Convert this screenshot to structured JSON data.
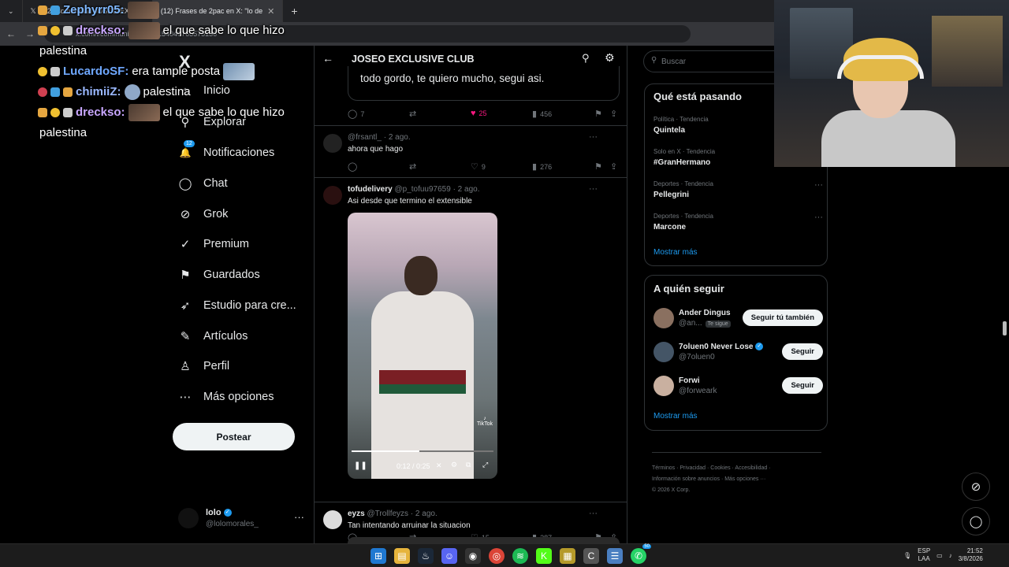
{
  "browser": {
    "tabs": [
      {
        "label": "(12) Comunidad JOSEO EXCL..."
      },
      {
        "label": "(12) Frases de 2pac en X: \"lo de",
        "active": true
      }
    ],
    "url": "x.com/i/communities/1803154040765575136"
  },
  "chat_overlay": [
    {
      "user": "Zephyrr05:",
      "msg": "",
      "color": "#7fb8ff"
    },
    {
      "user": "dreckso:",
      "msg": "el que sabe lo que hizo",
      "color": "#c9a7ff"
    },
    {
      "user": "",
      "msg": "palestina",
      "color": "#ffffff"
    },
    {
      "user": "LucardoSF:",
      "msg": "era tample posta",
      "color": "#6fa8ff"
    },
    {
      "user": "chimiiZ:",
      "msg": "palestina",
      "color": "#9ab8ff"
    },
    {
      "user": "dreckso:",
      "msg": "el que sabe lo que hizo",
      "color": "#c9a7ff"
    },
    {
      "user": "",
      "msg": "palestina",
      "color": "#ffffff"
    }
  ],
  "nav": {
    "logo": "X",
    "items": [
      {
        "label": "Inicio",
        "icon": "home-icon",
        "glyph": "⌂"
      },
      {
        "label": "Explorar",
        "icon": "search-icon",
        "glyph": "⚲"
      },
      {
        "label": "Notificaciones",
        "icon": "bell-icon",
        "glyph": "🔔",
        "badge": "12"
      },
      {
        "label": "Chat",
        "icon": "chat-bubble-icon",
        "glyph": "◯"
      },
      {
        "label": "Grok",
        "icon": "grok-icon",
        "glyph": "⊘"
      },
      {
        "label": "Premium",
        "icon": "premium-check-icon",
        "glyph": "✓"
      },
      {
        "label": "Guardados",
        "icon": "bookmark-icon",
        "glyph": "⚑"
      },
      {
        "label": "Estudio para cre...",
        "icon": "rocket-icon",
        "glyph": "➶"
      },
      {
        "label": "Artículos",
        "icon": "article-icon",
        "glyph": "✎"
      },
      {
        "label": "Perfil",
        "icon": "person-icon",
        "glyph": "♙"
      },
      {
        "label": "Más opciones",
        "icon": "more-options-icon",
        "glyph": "⋯"
      }
    ],
    "post_button": "Postear",
    "profile": {
      "name": "lolo",
      "handle": "@lolomorales_"
    }
  },
  "main": {
    "title": "JOSEO EXCLUSIVE CLUB",
    "quote_text": "todo gordo, te quiero mucho, segui asi.",
    "quote_actions": {
      "replies": "7",
      "reposts": "",
      "likes": "25",
      "views": "456"
    },
    "tweets": [
      {
        "name": "",
        "handle": "@frsantl_ · 2 ago.",
        "text": "ahora que hago",
        "replies": "",
        "reposts": "",
        "likes": "9",
        "views": "276"
      },
      {
        "name": "tofudelivery",
        "handle": "@p_tofuu97659 · 2 ago.",
        "text": "Asi desde que termino el extensible",
        "replies": "",
        "reposts": "",
        "likes": "15",
        "views": "287",
        "video": {
          "time": "0:12 / 0:25",
          "progress": 0.48,
          "watermark": "TikTok"
        }
      },
      {
        "name": "eyzs",
        "handle": "@Trollfeyzs · 2 ago.",
        "text": "Tan intentando arruinar la situacion"
      }
    ]
  },
  "right": {
    "search_placeholder": "Buscar",
    "trends_title": "Qué está pasando",
    "trends": [
      {
        "meta": "Política · Tendencia",
        "name": "Quintela"
      },
      {
        "meta": "Solo en X · Tendencia",
        "name": "#GranHermano"
      },
      {
        "meta": "Deportes · Tendencia",
        "name": "Pellegrini"
      },
      {
        "meta": "Deportes · Tendencia",
        "name": "Marcone"
      }
    ],
    "trends_more": "Mostrar más",
    "follow_title": "A quién seguir",
    "follow": [
      {
        "name": "Ander Dingus",
        "handle": "@an...",
        "tag": "Te sigue",
        "button": "Seguir tú también"
      },
      {
        "name": "7oluen0 Never Lose",
        "handle": "@7oluen0",
        "button": "Seguir"
      },
      {
        "name": "Forwi",
        "handle": "@forweark",
        "button": "Seguir"
      }
    ],
    "follow_more": "Mostrar más",
    "footer": {
      "line1": "Términos  ·  Privacidad  ·  Cookies  ·  Accesibilidad  ·",
      "line2": "Información sobre anuncios  ·  Más opciones ···",
      "line3": "© 2026 X Corp."
    }
  },
  "taskbar": {
    "lang": "ESP",
    "lang2": "LAA",
    "time": "21:52",
    "date": "3/8/2026",
    "whatsapp_badge": "50"
  }
}
